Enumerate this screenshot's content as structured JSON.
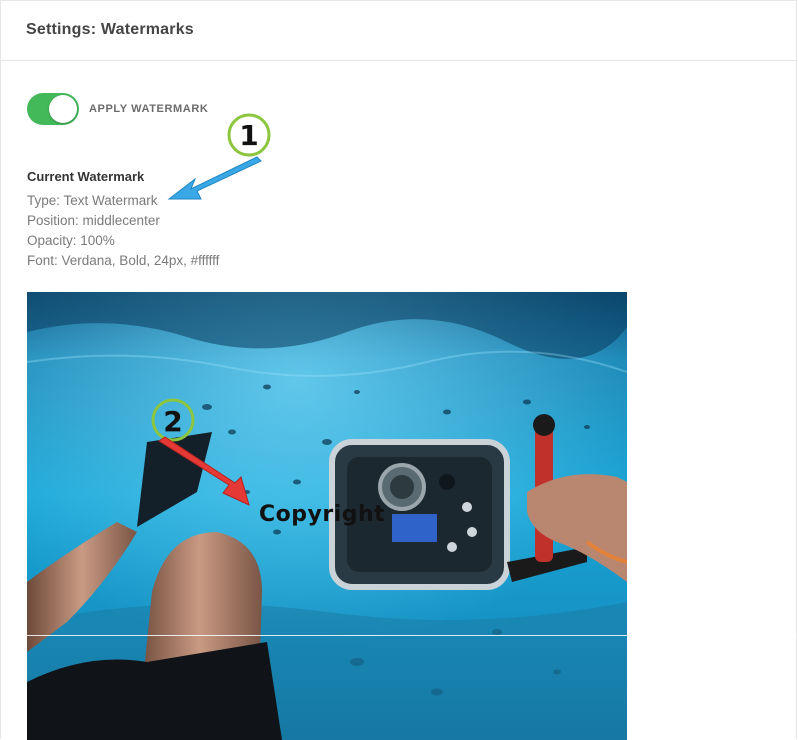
{
  "header": {
    "title": "Settings: Watermarks"
  },
  "toggle": {
    "label": "APPLY WATERMARK",
    "on": true,
    "color": "#43b95a"
  },
  "current": {
    "heading": "Current Watermark",
    "type": "Type: Text Watermark",
    "position": "Position: middlecenter",
    "opacity": "Opacity: 100%",
    "font": "Font: Verdana, Bold, 24px, #ffffff"
  },
  "preview": {
    "watermark_text": "Copyright",
    "description_icon": "underwater-photo"
  },
  "callouts": [
    {
      "number": "1",
      "arrow_color": "#3aa8e6",
      "ring_color": "#8cc63f"
    },
    {
      "number": "2",
      "arrow_color": "#e53935",
      "ring_color": "#8cc63f"
    }
  ]
}
